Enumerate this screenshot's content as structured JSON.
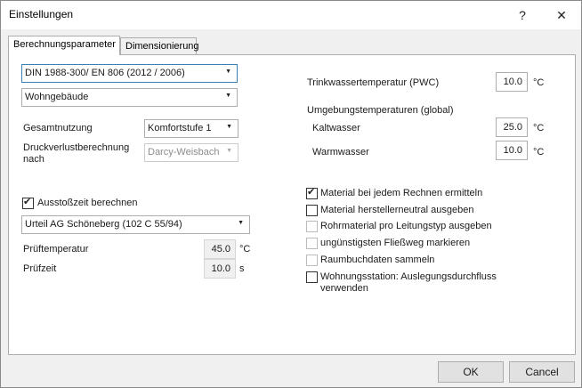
{
  "window": {
    "title": "Einstellungen",
    "help_icon": "?",
    "close_icon": "✕"
  },
  "tabs": [
    {
      "label": "Berechnungsparameter",
      "active": true
    },
    {
      "label": "Dimensionierung",
      "active": false
    }
  ],
  "left": {
    "norm_select": "DIN 1988-300/ EN 806 (2012 / 2006)",
    "building_select": "Wohngebäude",
    "gesamtnutzung_label": "Gesamtnutzung",
    "gesamtnutzung_value": "Komfortstufe 1",
    "druckverlust_label_1": "Druckverlustberechnung",
    "druckverlust_label_2": "nach",
    "druckverlust_value": "Darcy-Weisbach",
    "ausstoss_label": "Ausstoßzeit berechnen",
    "ausstoss_checked": true,
    "urteil_select": "Urteil AG Schöneberg (102 C 55/94)",
    "prueftemp_label": "Prüftemperatur",
    "prueftemp_value": "45.0",
    "prueftemp_unit": "°C",
    "pruefzeit_label": "Prüfzeit",
    "pruefzeit_value": "10.0",
    "pruefzeit_unit": "s"
  },
  "right": {
    "pwc_label": "Trinkwassertemperatur (PWC)",
    "pwc_value": "10.0",
    "pwc_unit": "°C",
    "umgebung_label": "Umgebungstemperaturen (global)",
    "kalt_label": "Kaltwasser",
    "kalt_value": "25.0",
    "kalt_unit": "°C",
    "warm_label": "Warmwasser",
    "warm_value": "10.0",
    "warm_unit": "°C",
    "options": [
      {
        "label": "Material bei jedem Rechnen ermitteln",
        "checked": true,
        "enabled": true
      },
      {
        "label": "Material herstellerneutral ausgeben",
        "checked": false,
        "enabled": true
      },
      {
        "label": "Rohrmaterial pro Leitungstyp ausgeben",
        "checked": false,
        "enabled": false
      },
      {
        "label": "ungünstigsten Fließweg markieren",
        "checked": false,
        "enabled": false
      },
      {
        "label": "Raumbuchdaten sammeln",
        "checked": false,
        "enabled": false
      },
      {
        "label": "Wohnungsstation: Auslegungsdurchfluss",
        "label_2": "verwenden",
        "checked": false,
        "enabled": true
      }
    ]
  },
  "buttons": {
    "ok": "OK",
    "cancel": "Cancel"
  },
  "icons": {
    "dropdown_arrow": "▼",
    "checkmark": "✔"
  }
}
